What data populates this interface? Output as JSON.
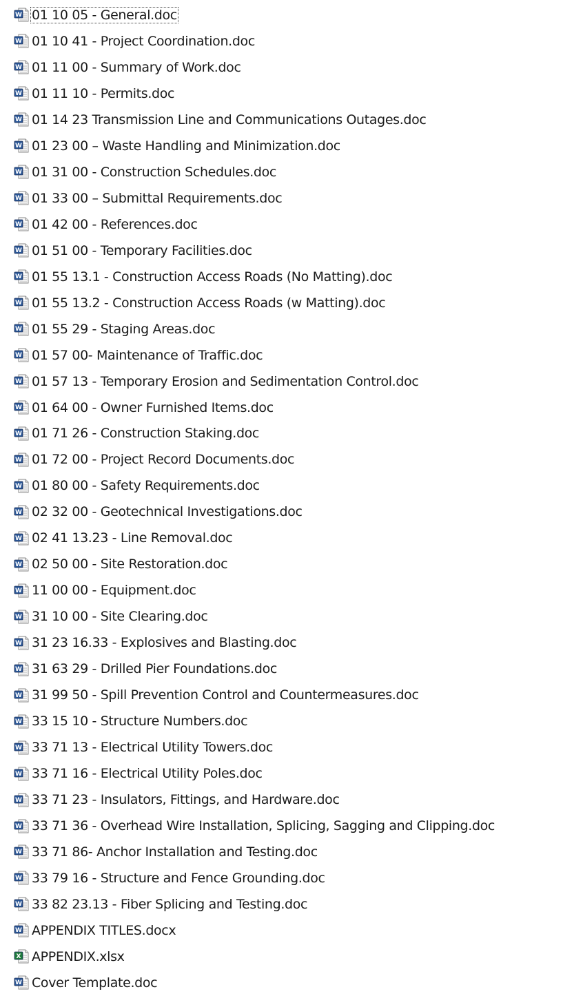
{
  "files": [
    {
      "name": "01 10 05 - General.doc",
      "icon": "word-document-icon",
      "selected": true
    },
    {
      "name": "01 10 41 - Project Coordination.doc",
      "icon": "word-document-icon"
    },
    {
      "name": "01 11 00 - Summary of Work.doc",
      "icon": "word-document-icon"
    },
    {
      "name": "01 11 10 -  Permits.doc",
      "icon": "word-document-icon"
    },
    {
      "name": "01 14 23 Transmission Line and Communications Outages.doc",
      "icon": "word-document-icon"
    },
    {
      "name": "01 23 00 – Waste Handling and Minimization.doc",
      "icon": "word-document-icon"
    },
    {
      "name": "01 31 00 -  Construction Schedules.doc",
      "icon": "word-document-icon"
    },
    {
      "name": "01 33 00 – Submittal Requirements.doc",
      "icon": "word-document-icon"
    },
    {
      "name": "01 42 00 - References.doc",
      "icon": "word-document-icon"
    },
    {
      "name": "01 51 00 - Temporary Facilities.doc",
      "icon": "word-document-icon"
    },
    {
      "name": "01 55 13.1 -  Construction Access Roads (No Matting).doc",
      "icon": "word-document-icon"
    },
    {
      "name": "01 55 13.2 -  Construction Access Roads (w Matting).doc",
      "icon": "word-document-icon"
    },
    {
      "name": "01 55 29 - Staging Areas.doc",
      "icon": "word-document-icon"
    },
    {
      "name": "01 57 00- Maintenance of Traffic.doc",
      "icon": "word-document-icon"
    },
    {
      "name": "01 57 13 - Temporary Erosion and Sedimentation Control.doc",
      "icon": "word-document-icon"
    },
    {
      "name": "01 64 00 - Owner Furnished Items.doc",
      "icon": "word-document-icon"
    },
    {
      "name": "01 71 26 - Construction Staking.doc",
      "icon": "word-document-icon"
    },
    {
      "name": "01 72 00 - Project Record Documents.doc",
      "icon": "word-document-icon"
    },
    {
      "name": "01 80 00 - Safety Requirements.doc",
      "icon": "word-document-icon"
    },
    {
      "name": "02 32 00 - Geotechnical Investigations.doc",
      "icon": "word-document-icon"
    },
    {
      "name": "02 41 13.23 -  Line Removal.doc",
      "icon": "word-document-icon"
    },
    {
      "name": "02 50 00 - Site Restoration.doc",
      "icon": "word-document-icon"
    },
    {
      "name": "11 00 00 - Equipment.doc",
      "icon": "word-document-icon"
    },
    {
      "name": "31 10 00 - Site Clearing.doc",
      "icon": "word-document-icon"
    },
    {
      "name": "31 23 16.33 - Explosives and Blasting.doc",
      "icon": "word-document-icon"
    },
    {
      "name": "31 63 29 - Drilled Pier Foundations.doc",
      "icon": "word-document-icon"
    },
    {
      "name": "31 99 50 - Spill Prevention Control and Countermeasures.doc",
      "icon": "word-document-icon"
    },
    {
      "name": "33 15 10 - Structure Numbers.doc",
      "icon": "word-document-icon"
    },
    {
      "name": "33 71 13 - Electrical Utility Towers.doc",
      "icon": "word-document-icon"
    },
    {
      "name": "33 71 16 -  Electrical Utility Poles.doc",
      "icon": "word-document-icon"
    },
    {
      "name": "33 71 23 -  Insulators, Fittings, and Hardware.doc",
      "icon": "word-document-icon"
    },
    {
      "name": "33 71 36 - Overhead Wire Installation, Splicing, Sagging and Clipping.doc",
      "icon": "word-document-icon"
    },
    {
      "name": "33 71 86-  Anchor Installation and Testing.doc",
      "icon": "word-document-icon"
    },
    {
      "name": "33 79 16 - Structure and Fence Grounding.doc",
      "icon": "word-document-icon"
    },
    {
      "name": "33 82 23.13 -  Fiber Splicing and Testing.doc",
      "icon": "word-document-icon"
    },
    {
      "name": "APPENDIX TITLES.docx",
      "icon": "word-document-icon"
    },
    {
      "name": "APPENDIX.xlsx",
      "icon": "excel-spreadsheet-icon"
    },
    {
      "name": "Cover Template.doc",
      "icon": "word-document-icon"
    }
  ],
  "colors": {
    "word": "#2b5797",
    "excel": "#1e7a3c",
    "text": "#1b1b1b",
    "background": "#ffffff"
  }
}
